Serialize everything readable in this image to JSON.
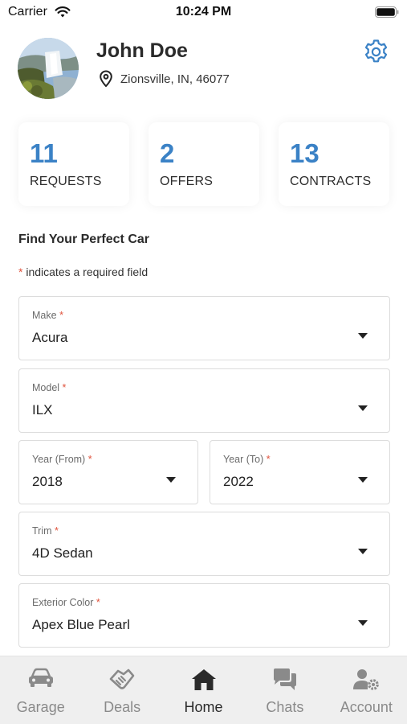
{
  "status_bar": {
    "carrier": "Carrier",
    "time": "10:24 PM"
  },
  "profile": {
    "name": "John Doe",
    "location": "Zionsville, IN, 46077"
  },
  "stats": [
    {
      "value": "11",
      "label": "REQUESTS"
    },
    {
      "value": "2",
      "label": "OFFERS"
    },
    {
      "value": "13",
      "label": "CONTRACTS"
    }
  ],
  "form": {
    "title": "Find Your Perfect Car",
    "required_marker": "*",
    "required_note": "indicates a required field",
    "fields": {
      "make": {
        "label": "Make",
        "value": "Acura"
      },
      "model": {
        "label": "Model",
        "value": "ILX"
      },
      "year_from": {
        "label": "Year (From)",
        "value": "2018"
      },
      "year_to": {
        "label": "Year (To)",
        "value": "2022"
      },
      "trim": {
        "label": "Trim",
        "value": "4D Sedan"
      },
      "exterior_color": {
        "label": "Exterior Color",
        "value": "Apex Blue Pearl"
      }
    }
  },
  "tabs": [
    {
      "label": "Garage",
      "icon": "car-icon",
      "active": false
    },
    {
      "label": "Deals",
      "icon": "handshake-icon",
      "active": false
    },
    {
      "label": "Home",
      "icon": "home-icon",
      "active": true
    },
    {
      "label": "Chats",
      "icon": "chat-icon",
      "active": false
    },
    {
      "label": "Account",
      "icon": "user-gear-icon",
      "active": false
    }
  ],
  "colors": {
    "accent": "#3b82c6",
    "required": "#e0533d",
    "tab_bar_bg": "#efefef"
  }
}
